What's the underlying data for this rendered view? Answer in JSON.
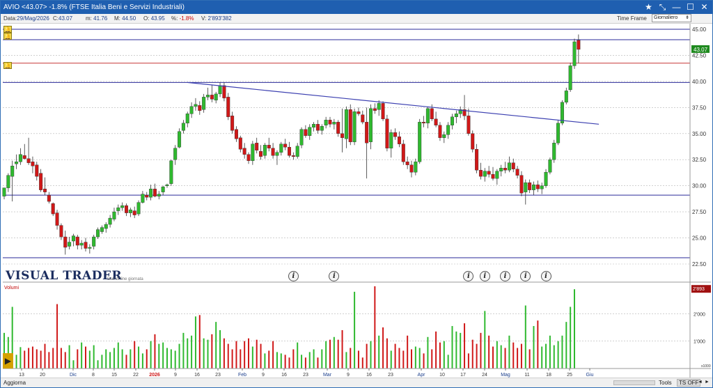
{
  "window": {
    "title": "AVIO <43.07> -1.8%  (FTSE Italia Beni e Servizi Industriali)",
    "buttons": [
      "★",
      "⤡",
      "—",
      "☐",
      "✕"
    ]
  },
  "infobar": {
    "date_label": "Data:",
    "date_value": "29/Mag/2026",
    "close_label": "C:",
    "close_value": "43.07",
    "min_label": "m:",
    "min_value": "41.76",
    "max_label": "M:",
    "max_value": "44.50",
    "open_label": "O:",
    "open_value": "43.95",
    "pct_label": "%:",
    "pct_value": "-1.8%",
    "vol_label": "V:",
    "vol_value": "2'893'382",
    "timeframe_label": "Time Frame",
    "timeframe_value": "Giornaliero"
  },
  "colors": {
    "up": "#2fb92f",
    "down": "#d01818",
    "hline": "#2a2a9a",
    "resistance": "#c83a3a",
    "trendline": "#3b3fb0",
    "grid": "#b5b5b5"
  },
  "logo": {
    "title": "VISUAL TRADER",
    "subtitle": "Dati di fine giornata"
  },
  "volume_panel": {
    "label": "Volumi",
    "unit_marker": "x1000"
  },
  "statusbar": {
    "update": "Aggiorna",
    "tools": "Tools",
    "tsoff": "TS OFF",
    "left_arrow": "◄",
    "right_arrow": "►"
  },
  "chart_data": {
    "type": "candlestick",
    "instrument": "AVIO",
    "price_axis": {
      "range": [
        22.5,
        45.0
      ],
      "ticks": [
        "45.00",
        "42.50",
        "40.00",
        "37.50",
        "35.00",
        "32.50",
        "30.00",
        "27.50",
        "25.00",
        "22.50"
      ],
      "last_label": "43.07"
    },
    "volume_axis": {
      "ticks": [
        "2'000",
        "1'000"
      ],
      "last_label": "2'893"
    },
    "x_labels": [
      "13",
      "20",
      "Dic",
      "8",
      "15",
      "22",
      "2026",
      "9",
      "16",
      "23",
      "Feb",
      "9",
      "16",
      "23",
      "Mar",
      "9",
      "16",
      "23",
      "Apr",
      "10",
      "17",
      "24",
      "Mag",
      "11",
      "18",
      "25",
      "Giu"
    ],
    "horizontal_lines": [
      {
        "price": 45.0,
        "color": "hline"
      },
      {
        "price": 44.0,
        "color": "hline"
      },
      {
        "price": 41.75,
        "color": "resistance"
      },
      {
        "price": 39.9,
        "color": "hline"
      },
      {
        "price": 29.1,
        "color": "hline"
      },
      {
        "price": 23.1,
        "color": "hline"
      }
    ],
    "trendline": {
      "from": {
        "bar": 45,
        "price": 39.9
      },
      "to": {
        "bar": 146,
        "price": 35.9
      }
    },
    "info_markers_at_bars": [
      71,
      81,
      114,
      118,
      123,
      128,
      133
    ],
    "candles_ohlc": [
      [
        29.0,
        29.8,
        28.7,
        29.8
      ],
      [
        29.8,
        31.2,
        29.4,
        31.0
      ],
      [
        30.9,
        32.4,
        28.5,
        31.9
      ],
      [
        32.1,
        33.0,
        31.6,
        32.3
      ],
      [
        32.3,
        33.6,
        32.0,
        33.0
      ],
      [
        32.9,
        34.0,
        32.5,
        32.6
      ],
      [
        32.6,
        34.6,
        32.0,
        32.2
      ],
      [
        32.3,
        32.8,
        31.2,
        31.9
      ],
      [
        32.0,
        32.3,
        30.5,
        30.9
      ],
      [
        31.2,
        31.6,
        29.4,
        29.6
      ],
      [
        29.7,
        30.8,
        29.1,
        29.4
      ],
      [
        29.1,
        29.4,
        28.3,
        28.5
      ],
      [
        28.3,
        28.4,
        27.1,
        27.3
      ],
      [
        27.4,
        27.7,
        25.8,
        26.2
      ],
      [
        26.2,
        26.4,
        24.8,
        25.1
      ],
      [
        25.1,
        25.7,
        23.4,
        24.1
      ],
      [
        24.2,
        25.1,
        23.9,
        24.6
      ],
      [
        24.7,
        25.4,
        24.2,
        25.2
      ],
      [
        25.1,
        25.3,
        23.9,
        24.3
      ],
      [
        24.3,
        24.8,
        23.9,
        24.5
      ],
      [
        24.6,
        25.0,
        23.7,
        24.0
      ],
      [
        24.0,
        24.4,
        23.5,
        24.1
      ],
      [
        24.2,
        25.3,
        23.9,
        25.1
      ],
      [
        25.1,
        26.0,
        24.9,
        25.8
      ],
      [
        25.6,
        26.2,
        25.4,
        26.0
      ],
      [
        25.9,
        26.5,
        25.5,
        26.3
      ],
      [
        26.3,
        27.2,
        26.0,
        26.9
      ],
      [
        26.8,
        27.9,
        26.6,
        27.5
      ],
      [
        27.6,
        28.2,
        27.2,
        27.9
      ],
      [
        27.9,
        28.4,
        27.6,
        28.1
      ],
      [
        28.1,
        28.3,
        27.1,
        27.4
      ],
      [
        27.4,
        27.9,
        27.0,
        27.7
      ],
      [
        27.6,
        28.0,
        26.9,
        27.2
      ],
      [
        27.3,
        28.6,
        27.1,
        28.4
      ],
      [
        28.4,
        29.5,
        28.3,
        29.2
      ],
      [
        29.1,
        29.4,
        28.6,
        28.9
      ],
      [
        28.9,
        30.1,
        28.6,
        29.7
      ],
      [
        29.7,
        30.2,
        28.9,
        29.0
      ],
      [
        29.0,
        29.5,
        28.7,
        29.2
      ],
      [
        29.4,
        30.0,
        29.1,
        29.9
      ],
      [
        30.0,
        30.2,
        29.8,
        30.1
      ],
      [
        30.2,
        32.5,
        30.0,
        32.4
      ],
      [
        32.5,
        33.9,
        32.0,
        33.6
      ],
      [
        33.7,
        35.5,
        33.6,
        35.2
      ],
      [
        35.3,
        36.3,
        35.0,
        36.0
      ],
      [
        36.0,
        37.1,
        35.6,
        36.9
      ],
      [
        36.9,
        38.0,
        36.5,
        37.6
      ],
      [
        37.6,
        38.4,
        37.2,
        37.8
      ],
      [
        37.7,
        38.1,
        36.8,
        37.2
      ],
      [
        37.3,
        38.8,
        37.0,
        38.5
      ],
      [
        38.5,
        39.4,
        38.2,
        38.7
      ],
      [
        38.7,
        39.7,
        38.0,
        38.3
      ],
      [
        38.2,
        39.0,
        37.9,
        38.8
      ],
      [
        38.8,
        39.9,
        38.5,
        39.6
      ],
      [
        39.6,
        39.9,
        38.1,
        38.4
      ],
      [
        38.5,
        38.9,
        36.3,
        36.6
      ],
      [
        36.7,
        37.1,
        35.0,
        35.3
      ],
      [
        35.4,
        35.7,
        34.2,
        34.5
      ],
      [
        34.6,
        34.8,
        33.2,
        33.5
      ],
      [
        33.6,
        34.1,
        32.6,
        33.0
      ],
      [
        33.0,
        33.2,
        32.1,
        32.4
      ],
      [
        32.4,
        34.3,
        32.0,
        34.0
      ],
      [
        34.1,
        34.6,
        33.1,
        33.4
      ],
      [
        33.3,
        33.9,
        32.5,
        32.8
      ],
      [
        32.9,
        34.1,
        32.6,
        33.9
      ],
      [
        33.9,
        34.6,
        33.3,
        33.6
      ],
      [
        33.6,
        34.1,
        32.6,
        32.9
      ],
      [
        32.9,
        33.4,
        32.0,
        33.2
      ],
      [
        33.2,
        34.2,
        32.9,
        34.0
      ],
      [
        34.0,
        34.5,
        33.4,
        33.7
      ],
      [
        33.7,
        34.2,
        32.7,
        32.9
      ],
      [
        32.9,
        33.2,
        32.5,
        32.8
      ],
      [
        32.8,
        34.1,
        32.6,
        33.8
      ],
      [
        33.9,
        35.6,
        33.6,
        35.4
      ],
      [
        35.4,
        35.8,
        34.6,
        34.8
      ],
      [
        34.8,
        35.9,
        34.4,
        35.6
      ],
      [
        35.6,
        36.1,
        35.2,
        35.9
      ],
      [
        35.9,
        36.3,
        35.0,
        35.3
      ],
      [
        35.3,
        35.9,
        34.9,
        35.7
      ],
      [
        35.8,
        36.6,
        35.5,
        36.3
      ],
      [
        36.3,
        36.6,
        35.6,
        35.9
      ],
      [
        35.9,
        36.4,
        35.4,
        36.1
      ],
      [
        36.1,
        36.3,
        34.7,
        35.0
      ],
      [
        35.0,
        37.4,
        33.2,
        34.6
      ],
      [
        34.5,
        37.6,
        33.6,
        37.3
      ],
      [
        37.3,
        37.8,
        33.9,
        34.2
      ],
      [
        34.2,
        37.4,
        33.9,
        37.1
      ],
      [
        37.1,
        37.5,
        36.7,
        36.9
      ],
      [
        36.8,
        37.2,
        35.9,
        36.1
      ],
      [
        36.1,
        37.5,
        30.7,
        34.1
      ],
      [
        34.2,
        37.8,
        33.5,
        37.4
      ],
      [
        37.4,
        37.9,
        36.9,
        37.2
      ],
      [
        37.3,
        38.2,
        36.7,
        37.9
      ],
      [
        37.9,
        38.1,
        36.2,
        36.4
      ],
      [
        36.4,
        36.8,
        33.3,
        33.6
      ],
      [
        33.6,
        35.4,
        32.7,
        35.1
      ],
      [
        35.1,
        35.5,
        34.4,
        34.7
      ],
      [
        34.7,
        35.2,
        33.7,
        34.0
      ],
      [
        34.0,
        34.4,
        32.0,
        32.3
      ],
      [
        32.3,
        32.8,
        31.6,
        32.0
      ],
      [
        32.0,
        32.4,
        30.8,
        31.3
      ],
      [
        31.3,
        32.6,
        31.0,
        32.3
      ],
      [
        32.3,
        36.4,
        32.1,
        36.1
      ],
      [
        36.1,
        36.7,
        35.6,
        36.0
      ],
      [
        36.0,
        37.6,
        35.5,
        37.4
      ],
      [
        37.4,
        37.8,
        36.2,
        36.4
      ],
      [
        36.4,
        37.1,
        35.6,
        35.8
      ],
      [
        35.8,
        36.1,
        34.3,
        34.6
      ],
      [
        34.6,
        35.2,
        34.1,
        34.9
      ],
      [
        34.9,
        36.1,
        34.5,
        35.8
      ],
      [
        35.8,
        36.9,
        35.4,
        36.6
      ],
      [
        36.6,
        37.2,
        36.0,
        36.9
      ],
      [
        36.9,
        37.6,
        36.5,
        37.3
      ],
      [
        37.3,
        38.7,
        36.3,
        36.7
      ],
      [
        36.7,
        37.4,
        34.8,
        35.0
      ],
      [
        35.0,
        35.3,
        33.2,
        33.5
      ],
      [
        33.5,
        34.0,
        31.2,
        31.5
      ],
      [
        31.5,
        32.2,
        30.6,
        30.9
      ],
      [
        30.9,
        31.7,
        30.4,
        31.4
      ],
      [
        31.4,
        31.9,
        30.8,
        31.1
      ],
      [
        31.1,
        31.8,
        30.5,
        30.7
      ],
      [
        30.7,
        31.6,
        30.1,
        31.4
      ],
      [
        31.4,
        32.0,
        30.9,
        31.7
      ],
      [
        31.7,
        32.3,
        31.2,
        31.5
      ],
      [
        31.5,
        32.8,
        31.3,
        32.2
      ],
      [
        32.2,
        32.6,
        31.3,
        31.6
      ],
      [
        31.6,
        31.9,
        30.7,
        31.0
      ],
      [
        31.0,
        31.4,
        29.0,
        29.3
      ],
      [
        29.4,
        30.6,
        28.2,
        30.3
      ],
      [
        30.3,
        30.6,
        29.3,
        29.6
      ],
      [
        29.6,
        30.4,
        29.1,
        30.1
      ],
      [
        30.1,
        30.5,
        29.4,
        29.7
      ],
      [
        29.7,
        30.3,
        29.2,
        30.0
      ],
      [
        30.0,
        31.6,
        29.8,
        31.3
      ],
      [
        31.3,
        32.7,
        31.1,
        32.5
      ],
      [
        32.5,
        34.4,
        32.2,
        34.1
      ],
      [
        34.1,
        36.3,
        33.9,
        36.0
      ],
      [
        36.0,
        38.2,
        35.8,
        38.0
      ],
      [
        38.0,
        39.4,
        37.8,
        39.1
      ],
      [
        39.2,
        41.8,
        39.0,
        41.5
      ],
      [
        41.5,
        44.1,
        41.2,
        43.8
      ],
      [
        43.95,
        44.5,
        41.76,
        43.07
      ]
    ],
    "volumes_thousands": [
      1300,
      1150,
      2250,
      500,
      780,
      650,
      750,
      800,
      700,
      650,
      900,
      600,
      750,
      2350,
      750,
      600,
      850,
      300,
      700,
      950,
      800,
      650,
      850,
      300,
      500,
      700,
      600,
      750,
      950,
      700,
      500,
      700,
      1000,
      800,
      550,
      700,
      1000,
      1250,
      900,
      950,
      750,
      700,
      650,
      900,
      1300,
      1100,
      1200,
      1900,
      1950,
      1100,
      1050,
      1250,
      1700,
      1400,
      1100,
      900,
      700,
      1000,
      700,
      1000,
      1100,
      800,
      1050,
      900,
      550,
      650,
      1000,
      600,
      550,
      500,
      400,
      700,
      950,
      500,
      400,
      600,
      700,
      400,
      700,
      1000,
      1050,
      1150,
      1050,
      1400,
      600,
      750,
      2800,
      650,
      400,
      900,
      1000,
      3000,
      1200,
      1500,
      1100,
      650,
      900,
      750,
      650,
      1200,
      700,
      800,
      750,
      550,
      1150,
      700,
      1350,
      950,
      1000,
      500,
      1550,
      1350,
      1300,
      1650,
      550,
      1050,
      900,
      1300,
      2100,
      1200,
      800,
      1000,
      850,
      750,
      1200,
      950,
      750,
      900,
      2300,
      700,
      1550,
      1750,
      800,
      900,
      1200,
      850,
      1000,
      1200,
      1700,
      2250,
      2893
    ]
  }
}
